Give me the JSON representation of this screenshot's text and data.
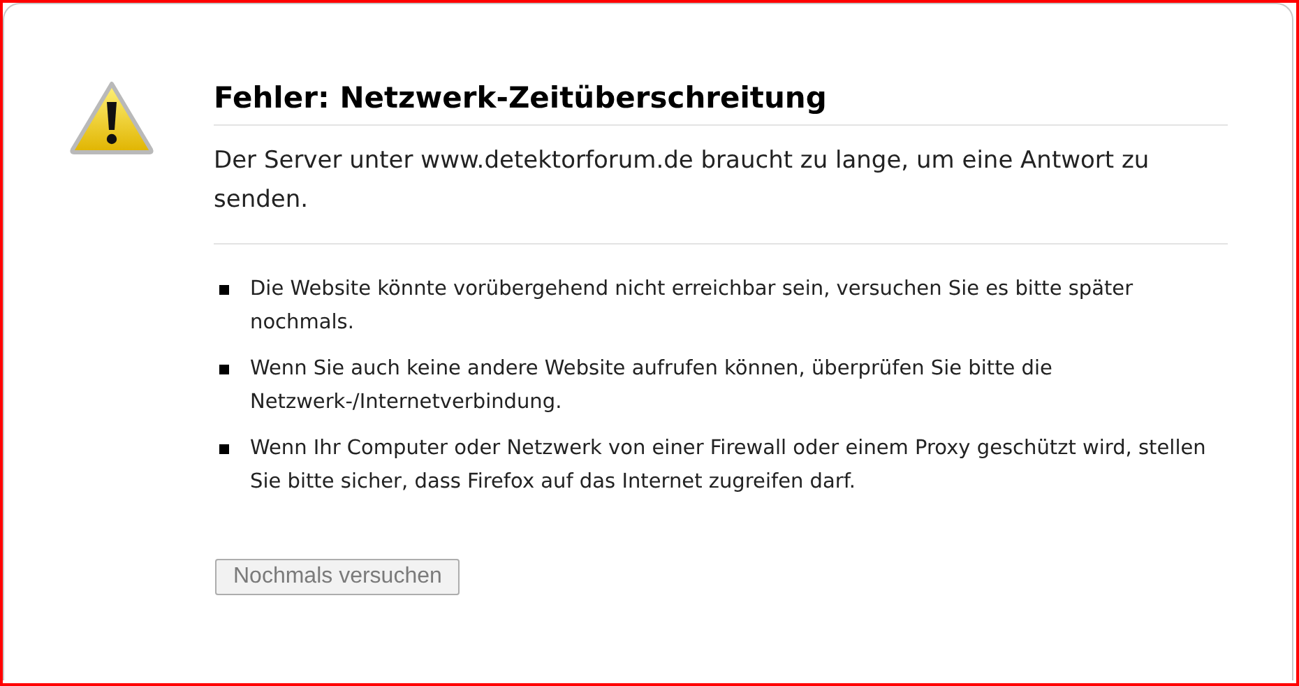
{
  "error": {
    "title": "Fehler: Netzwerk-Zeitüberschreitung",
    "description": "Der Server unter www.detektorforum.de braucht zu lange, um eine Antwort zu senden.",
    "suggestions": [
      "Die Website könnte vorübergehend nicht erreichbar sein, versuchen Sie es bitte später nochmals.",
      "Wenn Sie auch keine andere Website aufrufen können, überprüfen Sie bitte die Netzwerk-/Internetverbindung.",
      "Wenn Ihr Computer oder Netzwerk von einer Firewall oder einem Proxy geschützt wird, stellen Sie bitte sicher, dass Firefox auf das Internet zugreifen darf."
    ],
    "retry_button": {
      "label": "Nochmals versuchen",
      "disabled": true
    }
  }
}
